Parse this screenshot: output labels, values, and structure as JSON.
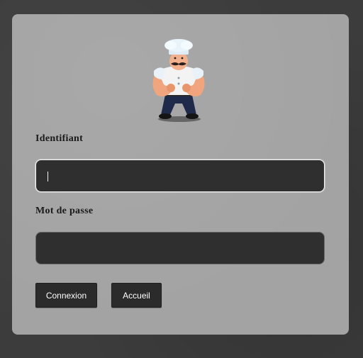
{
  "form": {
    "username_label": "Identifiant",
    "username_value": "",
    "password_label": "Mot de passe",
    "password_value": "",
    "login_button": "Connexion",
    "home_button": "Accueil"
  },
  "logo": {
    "icon": "chef-mascot-icon"
  }
}
